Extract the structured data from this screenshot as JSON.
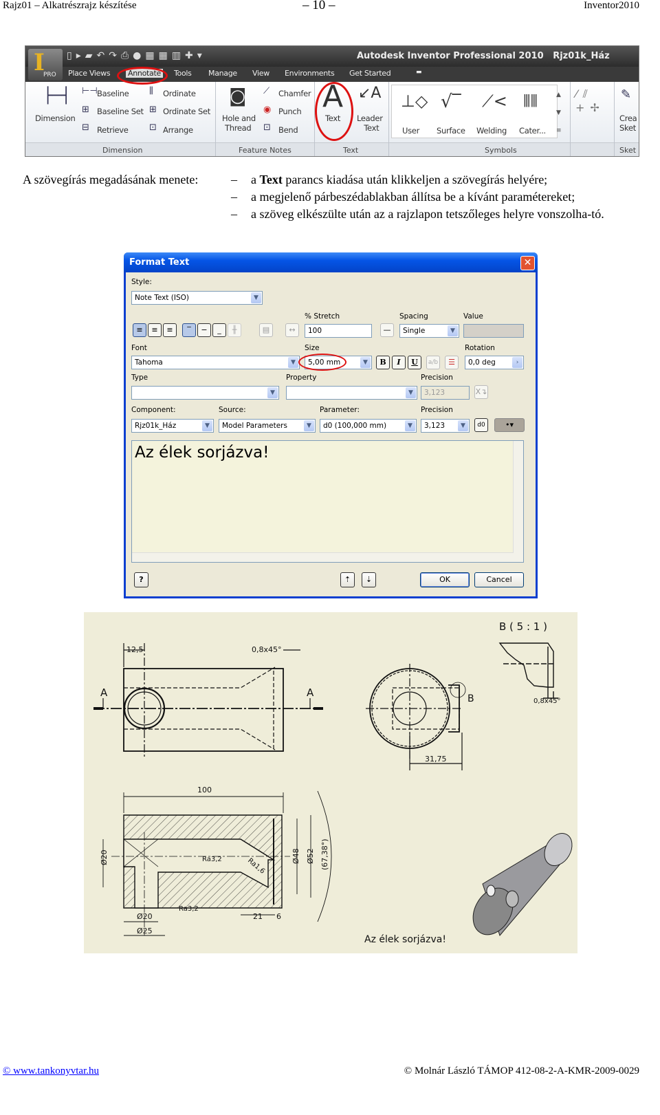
{
  "header": {
    "left": "Rajz01 – Alkatrészrajz készítése",
    "center": "– 10 –",
    "right": "Inventor2010"
  },
  "ribbon": {
    "title": "Autodesk Inventor Professional 2010   Rjz01k_Ház",
    "pro_badge": "PRO",
    "tabs": [
      "Place Views",
      "Annotate",
      "Tools",
      "Manage",
      "View",
      "Environments",
      "Get Started"
    ],
    "active_tab": "Annotate",
    "buttons": {
      "dimension": "Dimension",
      "baseline": "Baseline",
      "baseline_set": "Baseline Set",
      "retrieve": "Retrieve",
      "ordinate": "Ordinate",
      "ordinate_set": "Ordinate Set",
      "arrange": "Arrange",
      "hole_and": "Hole and",
      "thread": "Thread",
      "chamfer": "Chamfer",
      "punch": "Punch",
      "bend": "Bend",
      "text": "Text",
      "leader": "Leader",
      "leader_text": "Text",
      "user": "User",
      "surface": "Surface",
      "welding": "Welding",
      "cater": "Cater...",
      "crea": "Crea",
      "sket": "Sket"
    },
    "groups": [
      "Dimension",
      "Feature Notes",
      "Text",
      "Symbols",
      "Sket"
    ],
    "highlight_color": "#dd1111"
  },
  "instructions": {
    "label": "A szövegírás megadásának menete:",
    "steps": [
      {
        "pre": "a ",
        "bold": "Text",
        "post": " parancs kiadása után klikkeljen a szövegírás helyére;"
      },
      {
        "pre": "a megjelenő párbeszédablakban állítsa be a kívánt paramétereket;",
        "bold": "",
        "post": ""
      },
      {
        "pre": "a szöveg elkészülte után az a rajzlapon tetszőleges helyre vonszolha-tó.",
        "bold": "",
        "post": ""
      }
    ],
    "dash": "–"
  },
  "dialog": {
    "title": "Format Text",
    "style_label": "Style:",
    "style_value": "Note Text (ISO)",
    "stretch_label": "% Stretch",
    "stretch_value": "100",
    "spacing_label": "Spacing",
    "spacing_value": "Single",
    "value_label": "Value",
    "font_label": "Font",
    "font_value": "Tahoma",
    "size_label": "Size",
    "size_value": "5,00 mm",
    "bold": "B",
    "italic": "I",
    "underline": "U",
    "rotation_label": "Rotation",
    "rotation_value": "0,0 deg",
    "type_label": "Type",
    "property_label": "Property",
    "precision_label": "Precision",
    "precision_value_disabled": "3,123",
    "component_label": "Component:",
    "component_value": "Rjz01k_Ház",
    "source_label": "Source:",
    "source_value": "Model Parameters",
    "parameter_label": "Parameter:",
    "parameter_value": "d0 (100,000 mm)",
    "precision2_label": "Precision",
    "precision2_value": "3,123",
    "text_content": "Az élek sorjázva!",
    "ok": "OK",
    "cancel": "Cancel",
    "help": "?"
  },
  "drawing": {
    "detail_title": "B ( 5 : 1 )",
    "section_marks": [
      "A",
      "A"
    ],
    "detail_mark": "B",
    "dims": {
      "d12_5": "12,5",
      "chamfer1": "0,8x45°",
      "chamfer2": "0,8x45°",
      "d31_75": "31,75",
      "d100": "100",
      "dia20_left": "Ø20",
      "ra32_a": "Ra3,2",
      "ra16": "Ra1,6",
      "dia48": "Ø48",
      "dia52": "Ø52",
      "angle": "(67,38°)",
      "ra32_b": "Ra3,2",
      "dia20_bottom": "Ø20",
      "d21": "21",
      "d6": "6",
      "dia25": "Ø25"
    },
    "note": "Az élek sorjázva!"
  },
  "footer": {
    "left": "© www.tankonyvtar.hu",
    "right": "© Molnár László TÁMOP 412-08-2-A-KMR-2009-0029"
  }
}
